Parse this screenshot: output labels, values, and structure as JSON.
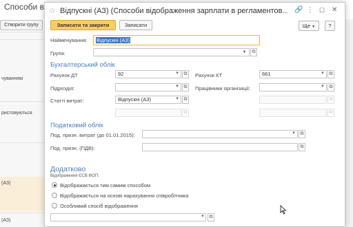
{
  "background": {
    "title": "Способи від",
    "toolbar_button": "Створити групу",
    "rows": [
      "чуванням",
      "ристовуються",
      "(АЗ)",
      "(АЗ)"
    ]
  },
  "dialog": {
    "title": "Відпускні (АЗ) (Способи відображення зарплати в регламентов...",
    "buttons": {
      "save_close": "Записати та закрити",
      "save": "Записати",
      "more": "Ще",
      "help": "?"
    },
    "name": {
      "label": "Найменування:",
      "value": "Відпускні (АЗ)"
    },
    "group": {
      "label": "Група:",
      "value": ""
    },
    "accounting": {
      "title": "Бухгалтерський облік",
      "debit_label": "Рахунок ДТ",
      "debit_value": "92",
      "credit_label": "Рахунок КТ",
      "credit_value": "661",
      "division_label": "Підрозділ:",
      "division_value": "",
      "employees_label": "Працівники організації:",
      "employees_value": "",
      "expenses_label": "Статті витрат:",
      "expenses_value": "Відпускні (АЗ)"
    },
    "tax": {
      "title": "Податковий облік",
      "purpose1_label": "Под. призн. витрат (до 01.01.2015):",
      "purpose1_value": "",
      "purpose2_label": "Под. призн. (ПДВ):",
      "purpose2_value": ""
    },
    "extra": {
      "title": "Додатково",
      "esv_label": "Відображення ЄСВ ФОП:",
      "options": [
        "Відображається тим самим способом",
        "Відображається на основі нарахування співробітника",
        "Особливий спосіб відображення"
      ],
      "selected_index": 0,
      "special_value": ""
    }
  },
  "colors": {
    "primary_button": "#fbcd63",
    "section_title": "#4a7cb8",
    "selection": "#3a73c4",
    "highlight_row": "#fbeed8"
  }
}
